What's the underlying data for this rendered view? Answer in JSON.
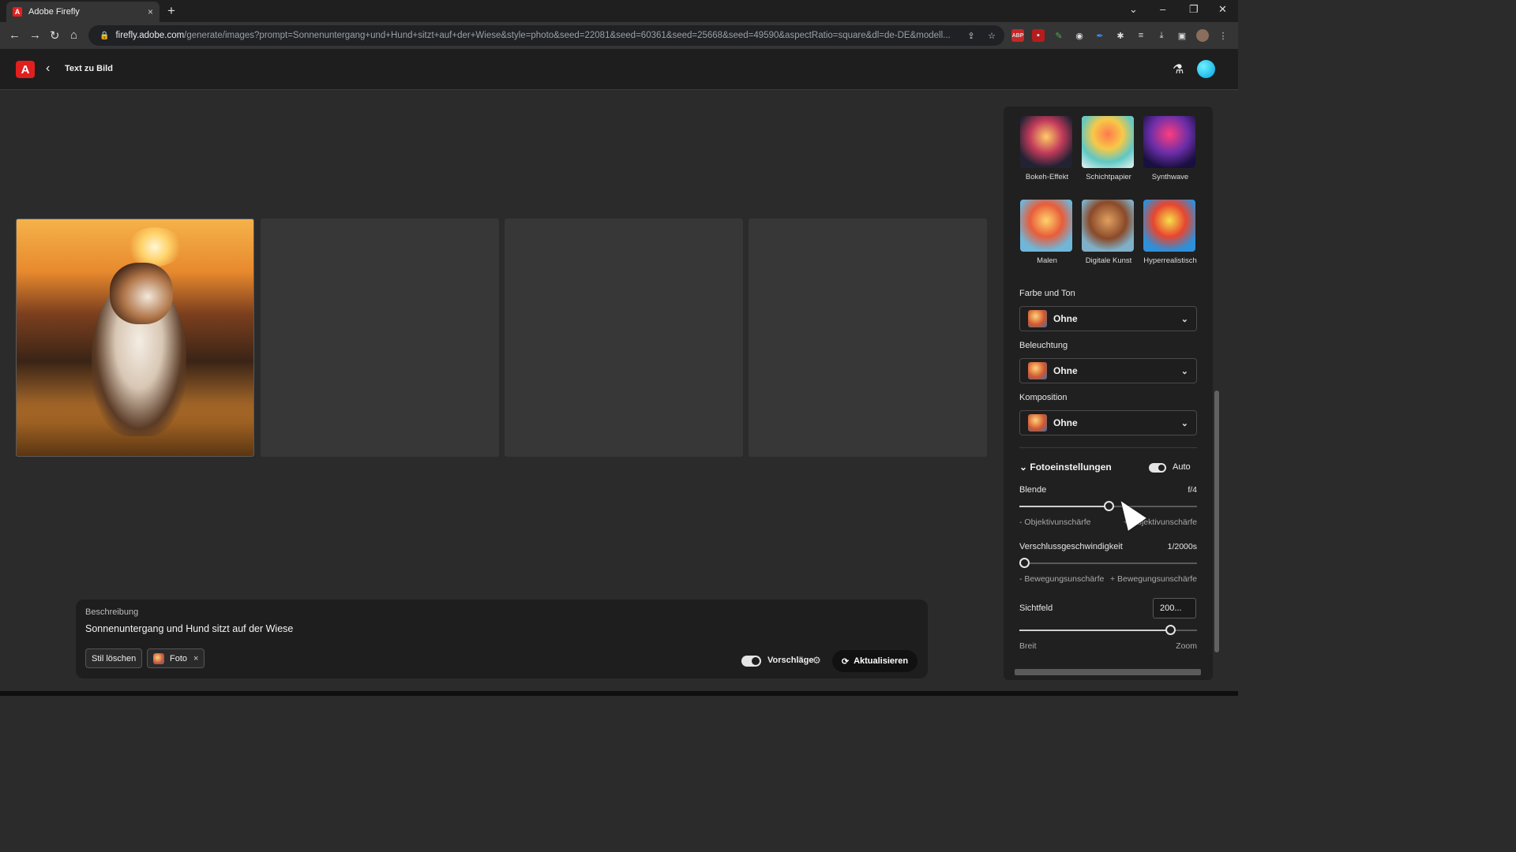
{
  "browser": {
    "tab_title": "Adobe Firefly",
    "tab_close": "×",
    "new_tab": "+",
    "url_host": "firefly.adobe.com",
    "url_path": "/generate/images?prompt=Sonnenuntergang+und+Hund+sitzt+auf+der+Wiese&style=photo&seed=22081&seed=60361&seed=25668&seed=49590&aspectRatio=square&dl=de-DE&modell..."
  },
  "app": {
    "logo": "A",
    "title": "Text zu Bild"
  },
  "prompt": {
    "label": "Beschreibung",
    "text": "Sonnenuntergang und Hund sitzt auf der Wiese",
    "clear_style": "Stil löschen",
    "style_chip": "Foto",
    "chip_remove": "×",
    "suggestions_label": "Vorschläge",
    "update_button": "Aktualisieren"
  },
  "panel": {
    "styles": [
      {
        "label": "Bokeh-Effekt"
      },
      {
        "label": "Schichtpapier"
      },
      {
        "label": "Synthwave"
      },
      {
        "label": "Malen"
      },
      {
        "label": "Digitale Kunst"
      },
      {
        "label": "Hyperrealistisch"
      }
    ],
    "color_tone": {
      "label": "Farbe und Ton",
      "value": "Ohne"
    },
    "lighting": {
      "label": "Beleuchtung",
      "value": "Ohne"
    },
    "composition": {
      "label": "Komposition",
      "value": "Ohne"
    },
    "photo_settings": {
      "title": "Fotoeinstellungen",
      "auto_label": "Auto",
      "aperture": {
        "label": "Blende",
        "value": "f/4",
        "level": 0.5,
        "min_hint": "- Objektivunschärfe",
        "max_hint": "+ Objektivunschärfe"
      },
      "shutter": {
        "label": "Verschlussgeschwindigkeit",
        "value": "1/2000s",
        "level": 0.0,
        "min_hint": "- Bewegungsunschärfe",
        "max_hint": "+ Bewegungsunschärfe"
      },
      "fov": {
        "label": "Sichtfeld",
        "value": "200...",
        "level": 0.85,
        "min_hint": "Breit",
        "max_hint": "Zoom"
      }
    }
  },
  "colors": {
    "accent_adobe": "#e01f1f",
    "avatar": "#00a3e0",
    "background": "#2b2b2b"
  }
}
